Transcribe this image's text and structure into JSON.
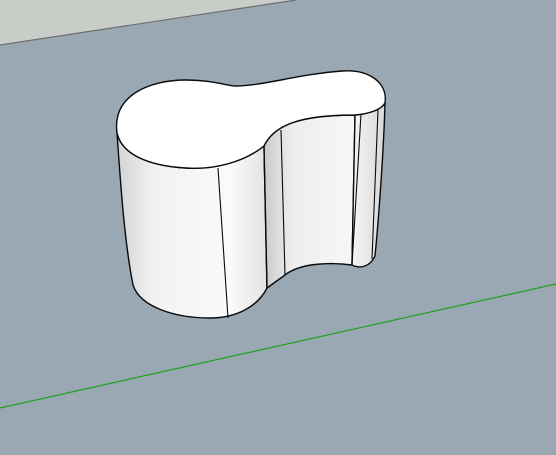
{
  "viewport": {
    "kind": "3d-modeling-viewport",
    "colors": {
      "sky": "#c9cdc8",
      "ground": "#9aa8b3",
      "horizon_line": "#6e6e6e",
      "green_axis": "#1fa01f",
      "model_fill": "#ffffff",
      "model_side_light": "#f4f4f4",
      "model_side_shadow": "#d6d6d6",
      "edge": "#0a0a0a"
    }
  }
}
